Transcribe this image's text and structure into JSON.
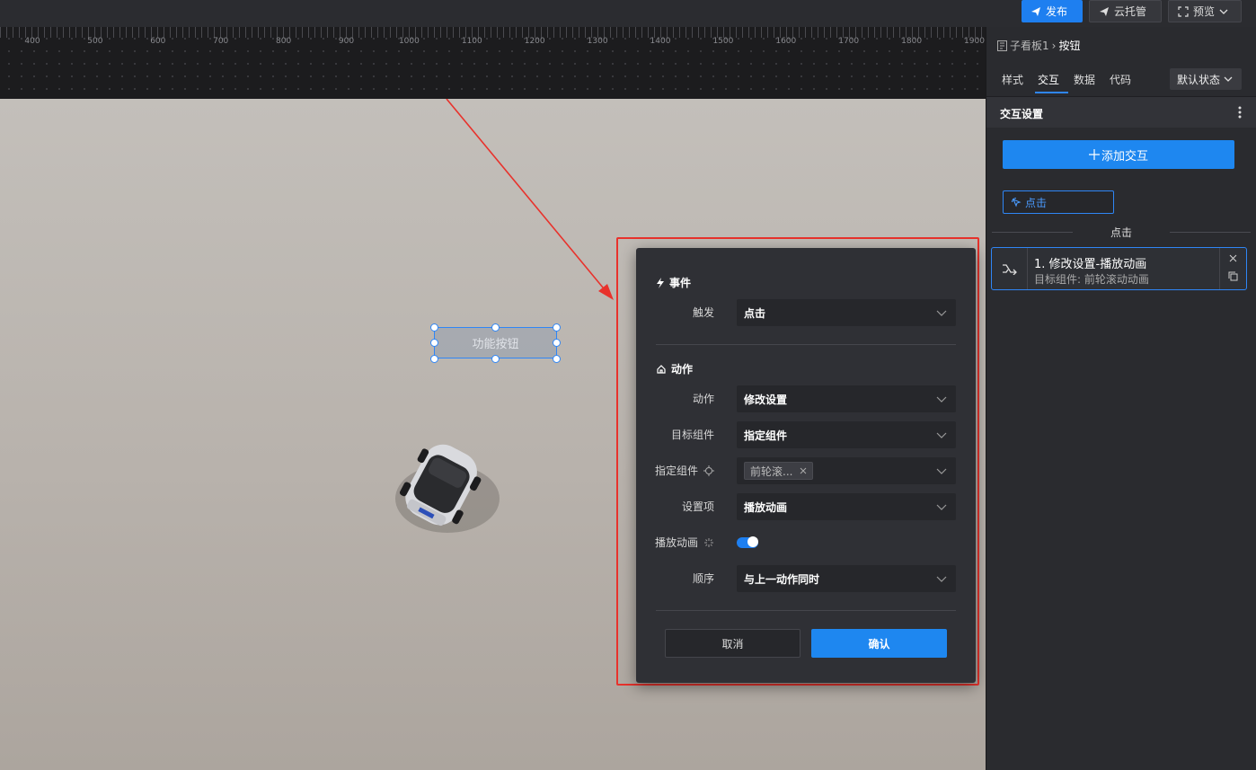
{
  "topbar": {
    "publish_label": "发布",
    "cloud_label": "云托管",
    "preview_label": "预览"
  },
  "ruler": {
    "labels": [
      "400",
      "500",
      "600",
      "700",
      "800",
      "900",
      "1000",
      "1100",
      "1200",
      "1300",
      "1400",
      "1500",
      "1600",
      "1700",
      "1800",
      "1900"
    ]
  },
  "canvas": {
    "function_button_label": "功能按钮"
  },
  "dialog": {
    "event_section": "事件",
    "trigger_label": "触发",
    "trigger_value": "点击",
    "action_section": "动作",
    "action_label": "动作",
    "action_value": "修改设置",
    "target_label": "目标组件",
    "target_value": "指定组件",
    "specified_label": "指定组件",
    "specified_tag": "前轮滚...",
    "setting_label": "设置项",
    "setting_value": "播放动画",
    "play_label": "播放动画",
    "play_enabled": true,
    "order_label": "顺序",
    "order_value": "与上一动作同时",
    "cancel_label": "取消",
    "confirm_label": "确认"
  },
  "panel": {
    "breadcrumb_parent": "子看板1",
    "breadcrumb_current": "按钮",
    "tabs": [
      {
        "label": "样式",
        "active": false
      },
      {
        "label": "交互",
        "active": true
      },
      {
        "label": "数据",
        "active": false
      },
      {
        "label": "代码",
        "active": false
      }
    ],
    "state_select": "默认状态",
    "section_title": "交互设置",
    "add_button": "添加交互",
    "event_chip": "点击",
    "event_separator": "点击",
    "action_card": {
      "title": "1. 修改设置-播放动画",
      "subtitle": "目标组件: 前轮滚动动画"
    }
  },
  "colors": {
    "accent": "#1e87f0",
    "highlight": "#e8322c",
    "panel_bg": "#2a2b2f",
    "dialog_bg": "#2f3035"
  }
}
